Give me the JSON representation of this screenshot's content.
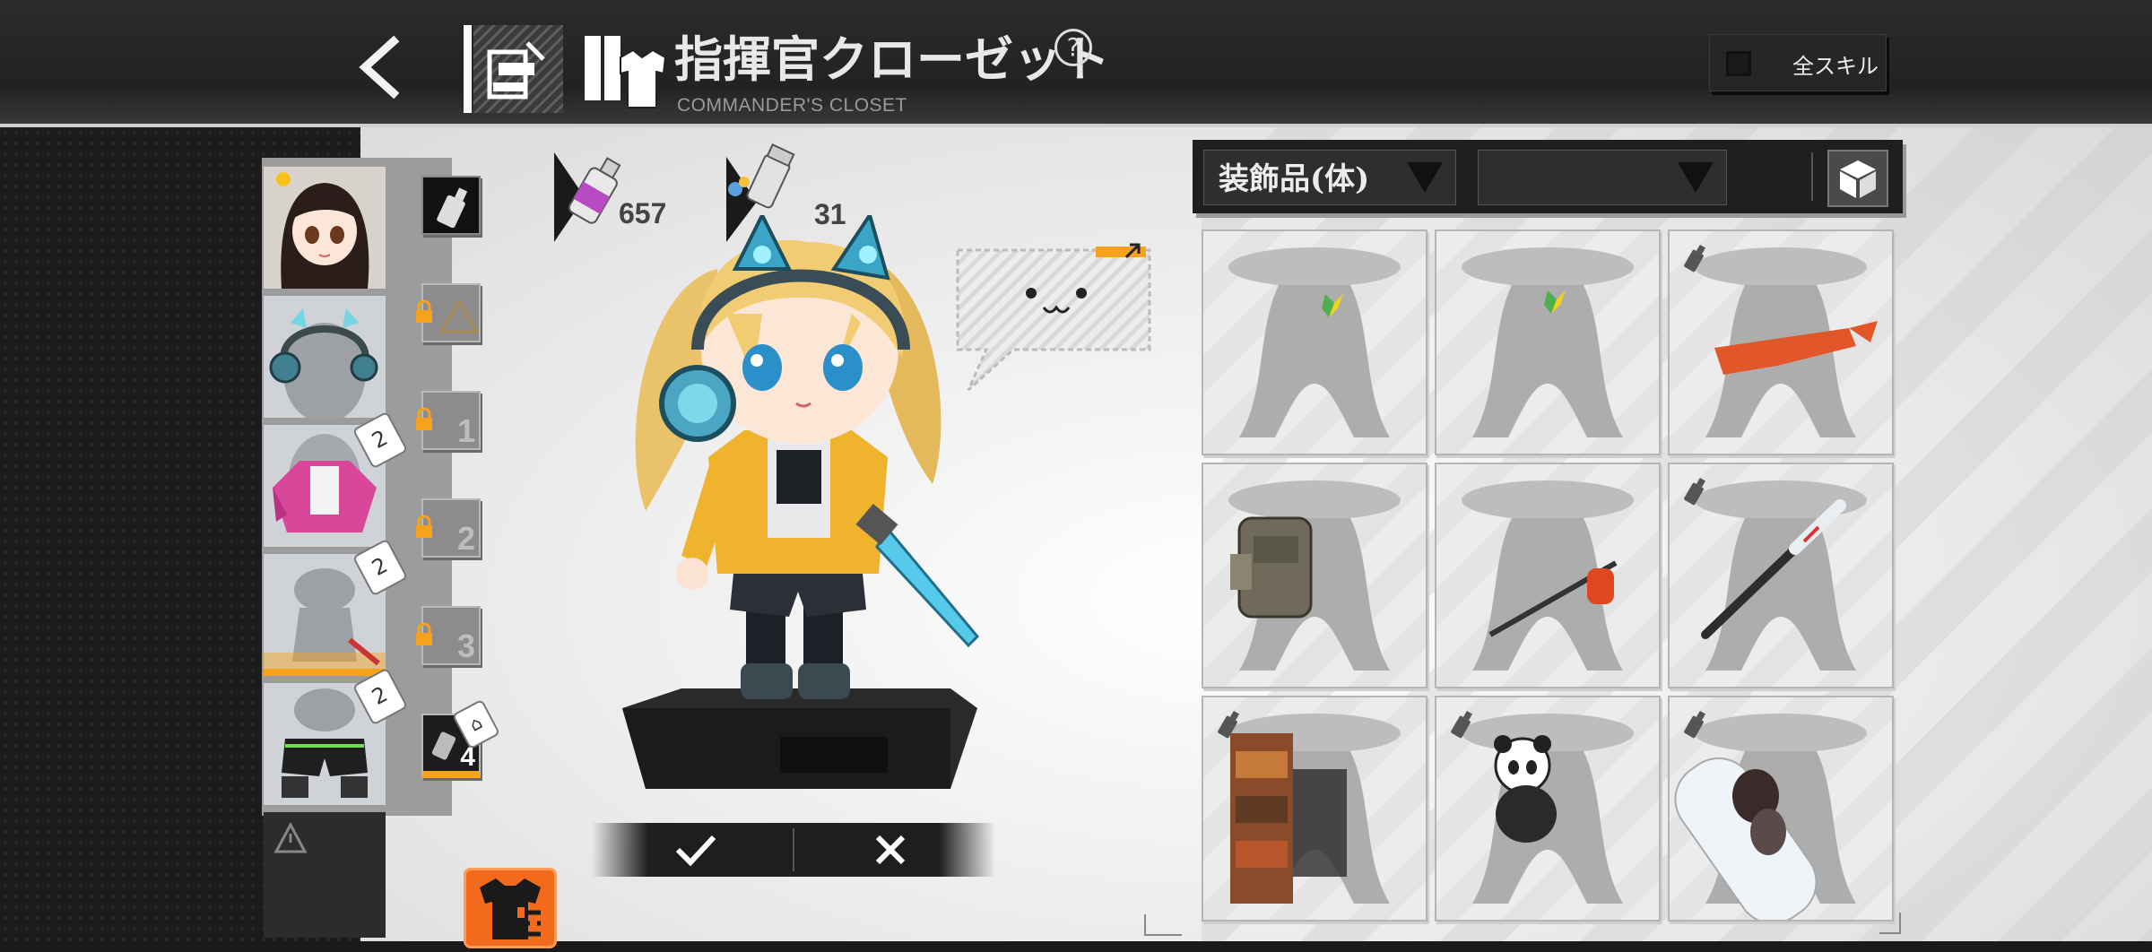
{
  "header": {
    "title": "指揮官クローゼット",
    "help_symbol": "?",
    "subtitle": "COMMANDER'S CLOSET",
    "all_skills": {
      "label": "全スキル",
      "checked": false
    }
  },
  "currency": {
    "dye_spray": "657",
    "dye_capsule": "31"
  },
  "slots": [
    {
      "number": "",
      "locked": false,
      "state": "dye"
    },
    {
      "number": "",
      "locked": true,
      "state": "warning"
    },
    {
      "number": "1",
      "locked": true
    },
    {
      "number": "2",
      "locked": true
    },
    {
      "number": "3",
      "locked": true
    },
    {
      "number": "4",
      "locked": false,
      "selected": true
    }
  ],
  "skins": [
    {
      "name": "default",
      "selected": false
    },
    {
      "name": "headphones-accessory",
      "selected": false
    },
    {
      "name": "pink-jacket-outfit",
      "hanger": "2",
      "selected": false
    },
    {
      "name": "knife-accessory",
      "hanger": "2",
      "selected": true
    },
    {
      "name": "shorts-outfit",
      "hanger": "2",
      "selected": false
    },
    {
      "name": "empty-slot",
      "selected": false
    }
  ],
  "filter": {
    "category": "装飾品(体)",
    "subcategory": ""
  },
  "colors": {
    "accent_orange": "#f7a21b",
    "settings_orange": "#f26a1b"
  },
  "accessories": [
    {
      "name": "beginner-badge-left",
      "dyeable": false
    },
    {
      "name": "beginner-badge-center",
      "dyeable": false
    },
    {
      "name": "orange-bandana",
      "dyeable": true
    },
    {
      "name": "military-backpack",
      "dyeable": false
    },
    {
      "name": "paper-lantern-staff",
      "dyeable": false
    },
    {
      "name": "baseball-bat",
      "dyeable": true
    },
    {
      "name": "cardboard-backpack",
      "dyeable": true
    },
    {
      "name": "panda-plush",
      "dyeable": true
    },
    {
      "name": "hug-pillow",
      "dyeable": true
    }
  ]
}
